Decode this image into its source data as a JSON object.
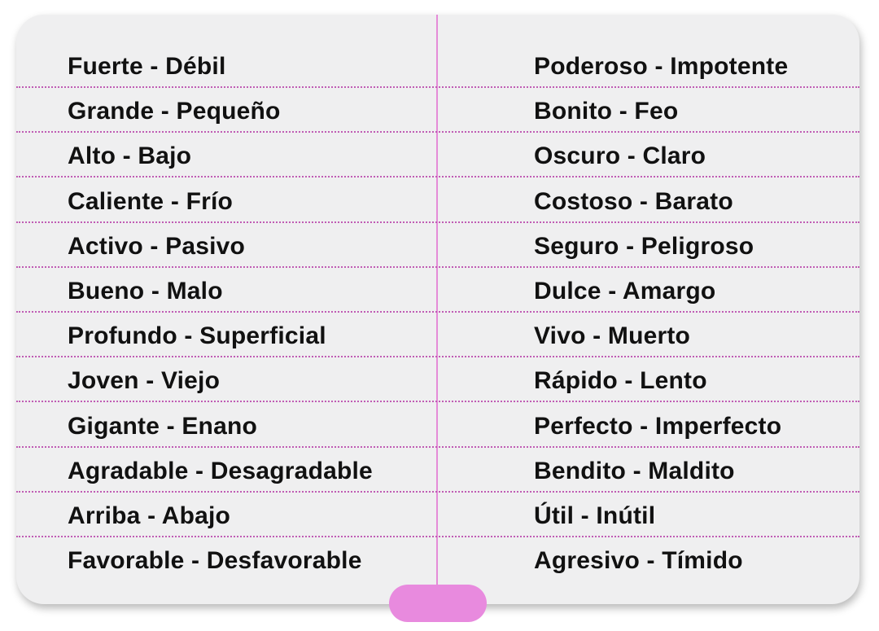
{
  "pairs": {
    "left": [
      "Fuerte - Débil",
      "Grande - Pequeño",
      "Alto - Bajo",
      "Caliente - Frío",
      "Activo - Pasivo",
      "Bueno - Malo",
      "Profundo - Superficial",
      "Joven - Viejo",
      "Gigante - Enano",
      "Agradable - Desagradable",
      "Arriba - Abajo",
      "Favorable - Desfavorable"
    ],
    "right": [
      "Poderoso - Impotente",
      "Bonito - Feo",
      "Oscuro - Claro",
      "Costoso - Barato",
      "Seguro - Peligroso",
      "Dulce - Amargo",
      "Vivo - Muerto",
      "Rápido - Lento",
      "Perfecto - Imperfecto",
      "Bendito - Maldito",
      "Útil - Inútil",
      "Agresivo - Tímido"
    ]
  },
  "colors": {
    "card_background": "#efeff0",
    "divider": "#e58bd8",
    "row_line": "#c05cb4",
    "tab": "#e88ade",
    "text": "#111111"
  }
}
